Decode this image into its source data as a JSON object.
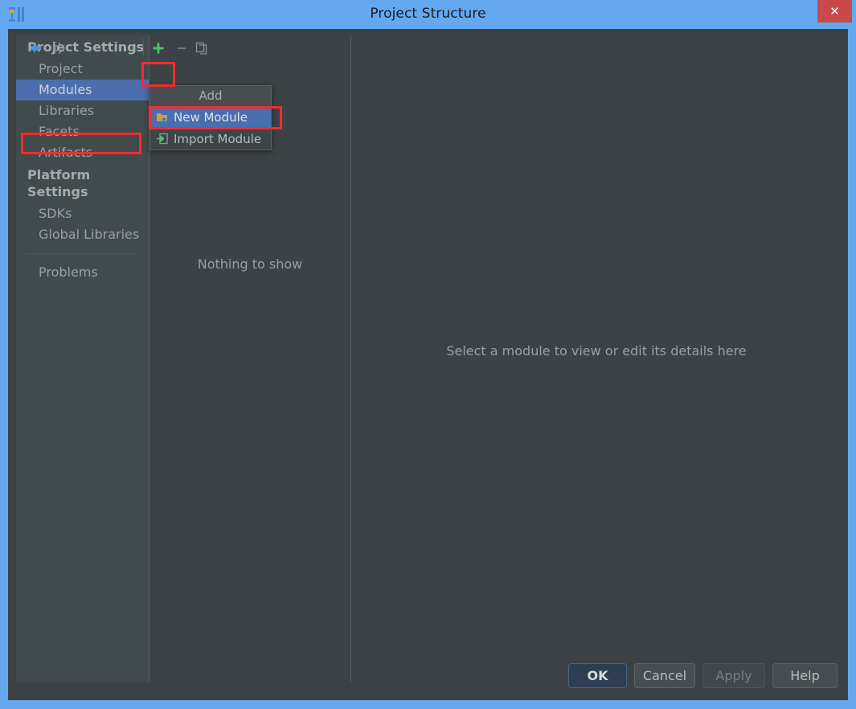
{
  "window": {
    "title": "Project Structure",
    "app_icon": "intellij-logo-icon",
    "close_label": "✕",
    "accent_frame_color": "#64a9f0",
    "dialog_bg_color": "#3c4245",
    "selection_color": "#4b6eaf",
    "annotation_color": "#f42c2c"
  },
  "toolbar": {
    "back_icon": "arrow-left-icon",
    "forward_icon": "arrow-right-icon",
    "add_icon": "plus-icon",
    "remove_icon": "minus-icon",
    "copy_icon": "copy-icon"
  },
  "sidebar": {
    "groups": [
      {
        "label": "Project Settings",
        "items": [
          {
            "label": "Project",
            "selected": false
          },
          {
            "label": "Modules",
            "selected": true
          },
          {
            "label": "Libraries",
            "selected": false
          },
          {
            "label": "Facets",
            "selected": false
          },
          {
            "label": "Artifacts",
            "selected": false
          }
        ]
      },
      {
        "label": "Platform Settings",
        "items": [
          {
            "label": "SDKs",
            "selected": false
          },
          {
            "label": "Global Libraries",
            "selected": false
          }
        ]
      }
    ],
    "extra_items": [
      {
        "label": "Problems",
        "selected": false
      }
    ]
  },
  "middle_panel": {
    "empty_text": "Nothing to show"
  },
  "right_panel": {
    "hint_text": "Select a module to view or edit its details here"
  },
  "popup": {
    "title": "Add",
    "items": [
      {
        "label": "New Module",
        "icon": "new-folder-icon",
        "highlighted": true
      },
      {
        "label": "Import Module",
        "icon": "import-arrow-icon",
        "highlighted": false
      }
    ]
  },
  "footer": {
    "ok_label": "OK",
    "cancel_label": "Cancel",
    "apply_label": "Apply",
    "help_label": "Help"
  }
}
